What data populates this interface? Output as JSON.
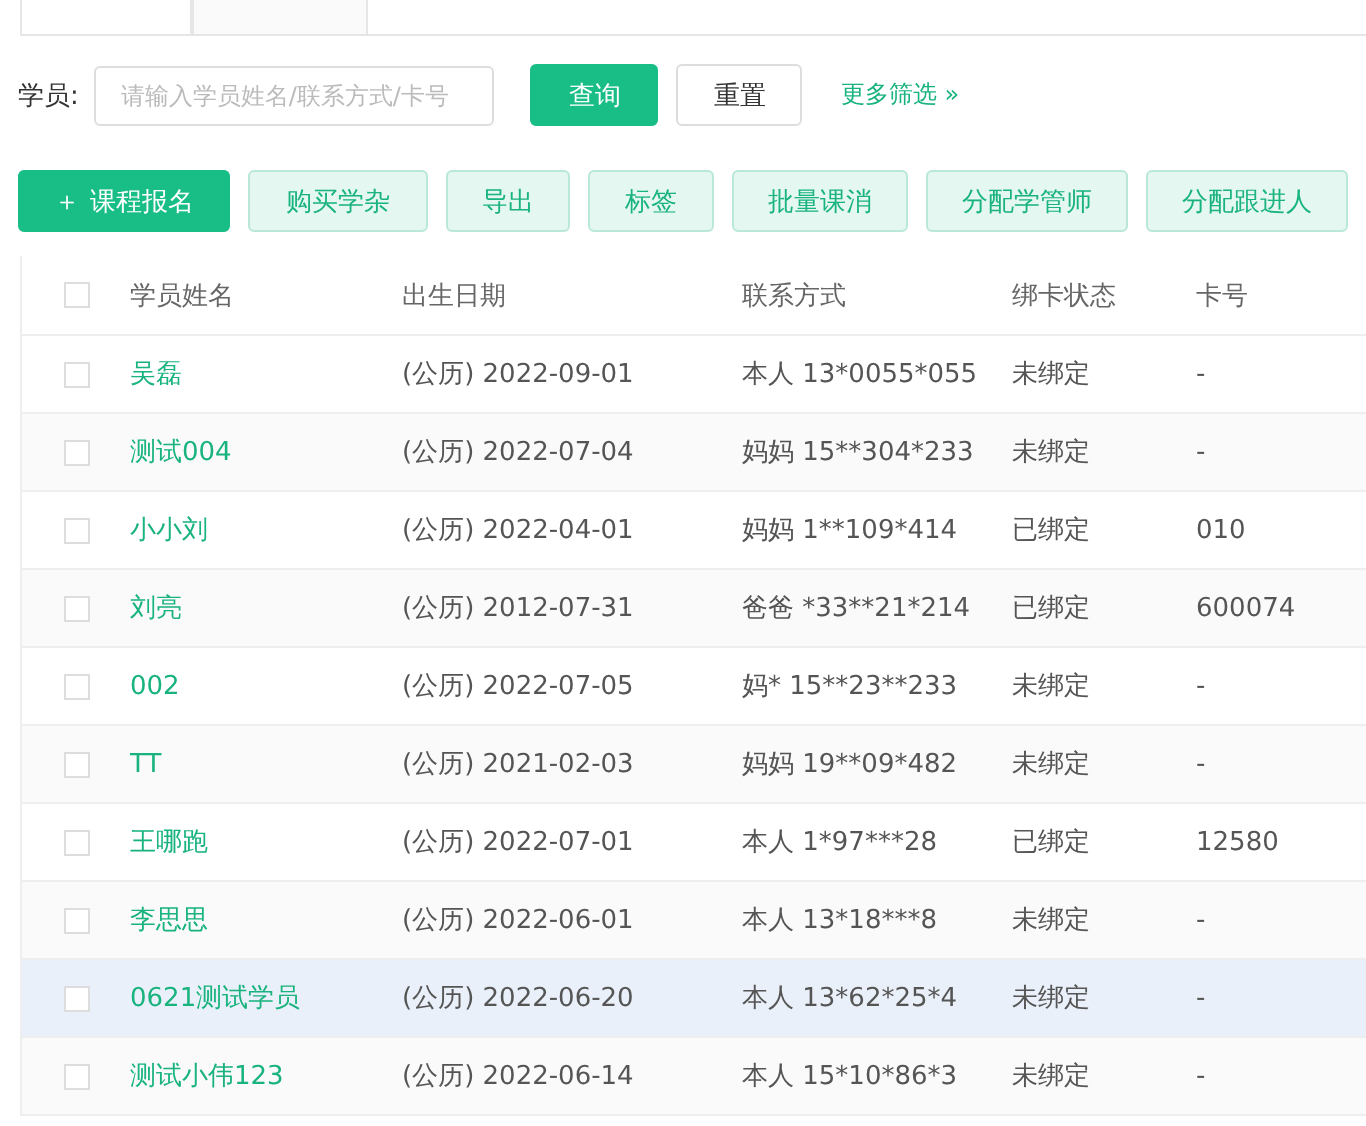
{
  "tabs": [
    {
      "selected": true
    },
    {
      "selected": false
    }
  ],
  "filter": {
    "label": "学员:",
    "placeholder": "请输入学员姓名/联系方式/卡号",
    "search_button": "查询",
    "reset_button": "重置",
    "more_link": "更多筛选 »"
  },
  "actions": [
    {
      "label": "课程报名",
      "icon": "＋",
      "primary": true
    },
    {
      "label": "购买学杂",
      "primary": false
    },
    {
      "label": "导出",
      "primary": false
    },
    {
      "label": "标签",
      "primary": false
    },
    {
      "label": "批量课消",
      "primary": false
    },
    {
      "label": "分配学管师",
      "primary": false
    },
    {
      "label": "分配跟进人",
      "primary": false
    }
  ],
  "table": {
    "columns": [
      "学员姓名",
      "出生日期",
      "联系方式",
      "绑卡状态",
      "卡号"
    ],
    "header_checked": false,
    "rows": [
      {
        "name": "吴磊",
        "birth": "(公历) 2022-09-01",
        "contact": "本人 13*0055*055",
        "bind": "未绑定",
        "card": "-",
        "checked": false,
        "hover": false
      },
      {
        "name": "测试004",
        "birth": "(公历) 2022-07-04",
        "contact": "妈妈 15**304*233",
        "bind": "未绑定",
        "card": "-",
        "checked": false,
        "hover": false
      },
      {
        "name": "小小刘",
        "birth": "(公历) 2022-04-01",
        "contact": "妈妈 1**109*414",
        "bind": "已绑定",
        "card": "010",
        "checked": false,
        "hover": false
      },
      {
        "name": "刘亮",
        "birth": "(公历) 2012-07-31",
        "contact": "爸爸 *33**21*214",
        "bind": "已绑定",
        "card": "600074",
        "checked": false,
        "hover": false
      },
      {
        "name": "002",
        "birth": "(公历) 2022-07-05",
        "contact": "妈* 15**23**233",
        "bind": "未绑定",
        "card": "-",
        "checked": false,
        "hover": false
      },
      {
        "name": "TT",
        "birth": "(公历) 2021-02-03",
        "contact": "妈妈 19**09*482",
        "bind": "未绑定",
        "card": "-",
        "checked": false,
        "hover": false
      },
      {
        "name": "王哪跑",
        "birth": "(公历) 2022-07-01",
        "contact": "本人 1*97***28",
        "bind": "已绑定",
        "card": "12580",
        "checked": false,
        "hover": false
      },
      {
        "name": "李思思",
        "birth": "(公历) 2022-06-01",
        "contact": "本人 13*18***8",
        "bind": "未绑定",
        "card": "-",
        "checked": false,
        "hover": false
      },
      {
        "name": "0621测试学员",
        "birth": "(公历) 2022-06-20",
        "contact": "本人 13*62*25*4",
        "bind": "未绑定",
        "card": "-",
        "checked": false,
        "hover": true
      },
      {
        "name": "测试小伟123",
        "birth": "(公历) 2022-06-14",
        "contact": "本人 15*10*86*3",
        "bind": "未绑定",
        "card": "-",
        "checked": false,
        "hover": false
      }
    ]
  }
}
